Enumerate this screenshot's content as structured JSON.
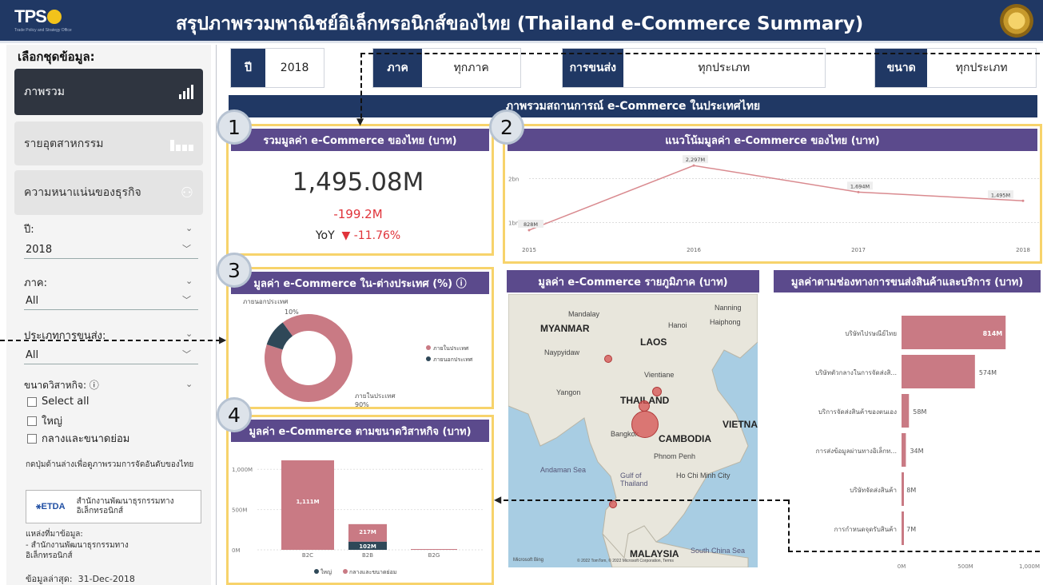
{
  "header": {
    "logo": "TPS",
    "logo_sub": "Trade Policy and Strategy Office",
    "title": "สรุปภาพรวมพาณิชย์อิเล็กทรอนิกส์ของไทย (Thailand e-Commerce Summary)"
  },
  "sidebar": {
    "heading": "เลือกชุดข้อมูล:",
    "nav": [
      {
        "label": "ภาพรวม"
      },
      {
        "label": "รายอุตสาหกรรม"
      },
      {
        "label": "ความหนาแน่นของธุรกิจ"
      }
    ],
    "filters": [
      {
        "label": "ปี:",
        "value": "2018"
      },
      {
        "label": "ภาค:",
        "value": "All"
      },
      {
        "label": "ประเภทการขนส่ง:",
        "value": "All"
      }
    ],
    "size_label": "ขนาดวิสาหกิจ: ⓘ",
    "size_options": [
      "Select all",
      "ใหญ่",
      "กลางและขนาดย่อม"
    ],
    "hint": "กดปุ่มด้านล่างเพื่อดูภาพรวมการจัดอันดับของไทย",
    "etda_logo": "ETDA",
    "etda_text": "สำนักงานพัฒนาธุรกรรมทางอิเล็กทรอนิกส์",
    "source_label": "แหล่งที่มาข้อมูล:",
    "source_text": "- สำนักงานพัฒนาธุรกรรมทางอิเล็กทรอนิกส์",
    "updated_label": "ข้อมูลล่าสุด:",
    "updated_value": "31-Dec-2018"
  },
  "filter_bar": {
    "year_key": "ปี",
    "year_value": "2018",
    "region_key": "ภาค",
    "region_value": "ทุกภาค",
    "transport_key": "การขนส่ง",
    "transport_value": "ทุกประเภท",
    "size_key": "ขนาด",
    "size_value": "ทุกประเภท"
  },
  "section_title": "ภาพรวมสถานการณ์ e-Commerce ในประเทศไทย",
  "badges": [
    "1",
    "2",
    "3",
    "4"
  ],
  "kpi": {
    "title": "รวมมูลค่า e-Commerce ของไทย (บาท)",
    "value": "1,495.08M",
    "change": "-199.2M",
    "yoy_label": "YoY",
    "yoy_value": "▼ -11.76%"
  },
  "trend": {
    "title": "แนวโน้มมูลค่า e-Commerce ของไทย (บาท)",
    "chart_data": {
      "type": "line",
      "x": [
        "2015",
        "2016",
        "2017",
        "2018"
      ],
      "values": [
        828,
        2297,
        1694,
        1495
      ],
      "data_labels": [
        "828M",
        "2,297M",
        "1,694M",
        "1,495M"
      ],
      "y_ticks": [
        "1bn",
        "2bn"
      ],
      "ylim": [
        500,
        2500
      ],
      "color": "#d98a8f"
    }
  },
  "donut": {
    "title": "มูลค่า e-Commerce ใน-ต่างประเทศ (%) ⓘ",
    "chart_data": {
      "type": "pie",
      "categories": [
        "ภายในประเทศ",
        "ภายนอกประเทศ"
      ],
      "values": [
        90,
        10
      ],
      "value_labels": [
        "90%",
        "10%"
      ],
      "colors": [
        "#c97a84",
        "#2f4858"
      ],
      "legend": "right"
    }
  },
  "size_chart": {
    "title": "มูลค่า e-Commerce ตามขนาดวิสาหกิจ (บาท)",
    "chart_data": {
      "type": "bar",
      "categories": [
        "B2C",
        "B2B",
        "B2G"
      ],
      "series": [
        {
          "name": "ใหญ่",
          "values": [
            0,
            102,
            0
          ],
          "color": "#2f4858"
        },
        {
          "name": "กลางและขนาดย่อม",
          "values": [
            1111,
            217,
            10
          ],
          "color": "#c97a84"
        }
      ],
      "data_labels": {
        "B2C": [
          "1,111M"
        ],
        "B2B": [
          "217M",
          "102M"
        ]
      },
      "y_ticks": [
        "0M",
        "500M",
        "1,000M"
      ],
      "ylim": [
        0,
        1250
      ],
      "legend": "bottom"
    }
  },
  "map": {
    "title": "มูลค่า e-Commerce รายภูมิภาค (บาท)",
    "labels": [
      "Mandalay",
      "MYANMAR",
      "Hanoi",
      "Haiphong",
      "Nanning",
      "LAOS",
      "Naypyidaw",
      "Vientiane",
      "Yangon",
      "THAILAND",
      "VIETNA",
      "Bangkok",
      "CAMBODIA",
      "Phnom Penh",
      "Andaman Sea",
      "Gulf of Thailand",
      "Ho Chi Minh City",
      "South China Sea",
      "MALAYSIA"
    ],
    "attribution": "© 2022 TomTom, © 2022 Microsoft Corporation, Terms",
    "bing": "Microsoft Bing"
  },
  "transport_chart": {
    "title": "มูลค่าตามช่องทางการขนส่งสินค้าและบริการ (บาท)",
    "chart_data": {
      "type": "bar",
      "orientation": "horizontal",
      "categories": [
        "บริษัทไปรษณีย์ไทย",
        "บริษัทตัวกลางในการจัดส่งสิ...",
        "บริการจัดส่งสินค้าของตนเอง",
        "การส่งข้อมูลผ่านทางอิเล็กท...",
        "บริษัทจัดส่งสินค้า",
        "การกำหนดจุดรับสินค้า"
      ],
      "values": [
        814,
        574,
        58,
        34,
        8,
        7
      ],
      "value_labels": [
        "814M",
        "574M",
        "58M",
        "34M",
        "8M",
        "7M"
      ],
      "x_ticks": [
        "0M",
        "500M",
        "1,000M"
      ],
      "xlim": [
        0,
        1000
      ],
      "color": "#c97a84"
    }
  }
}
